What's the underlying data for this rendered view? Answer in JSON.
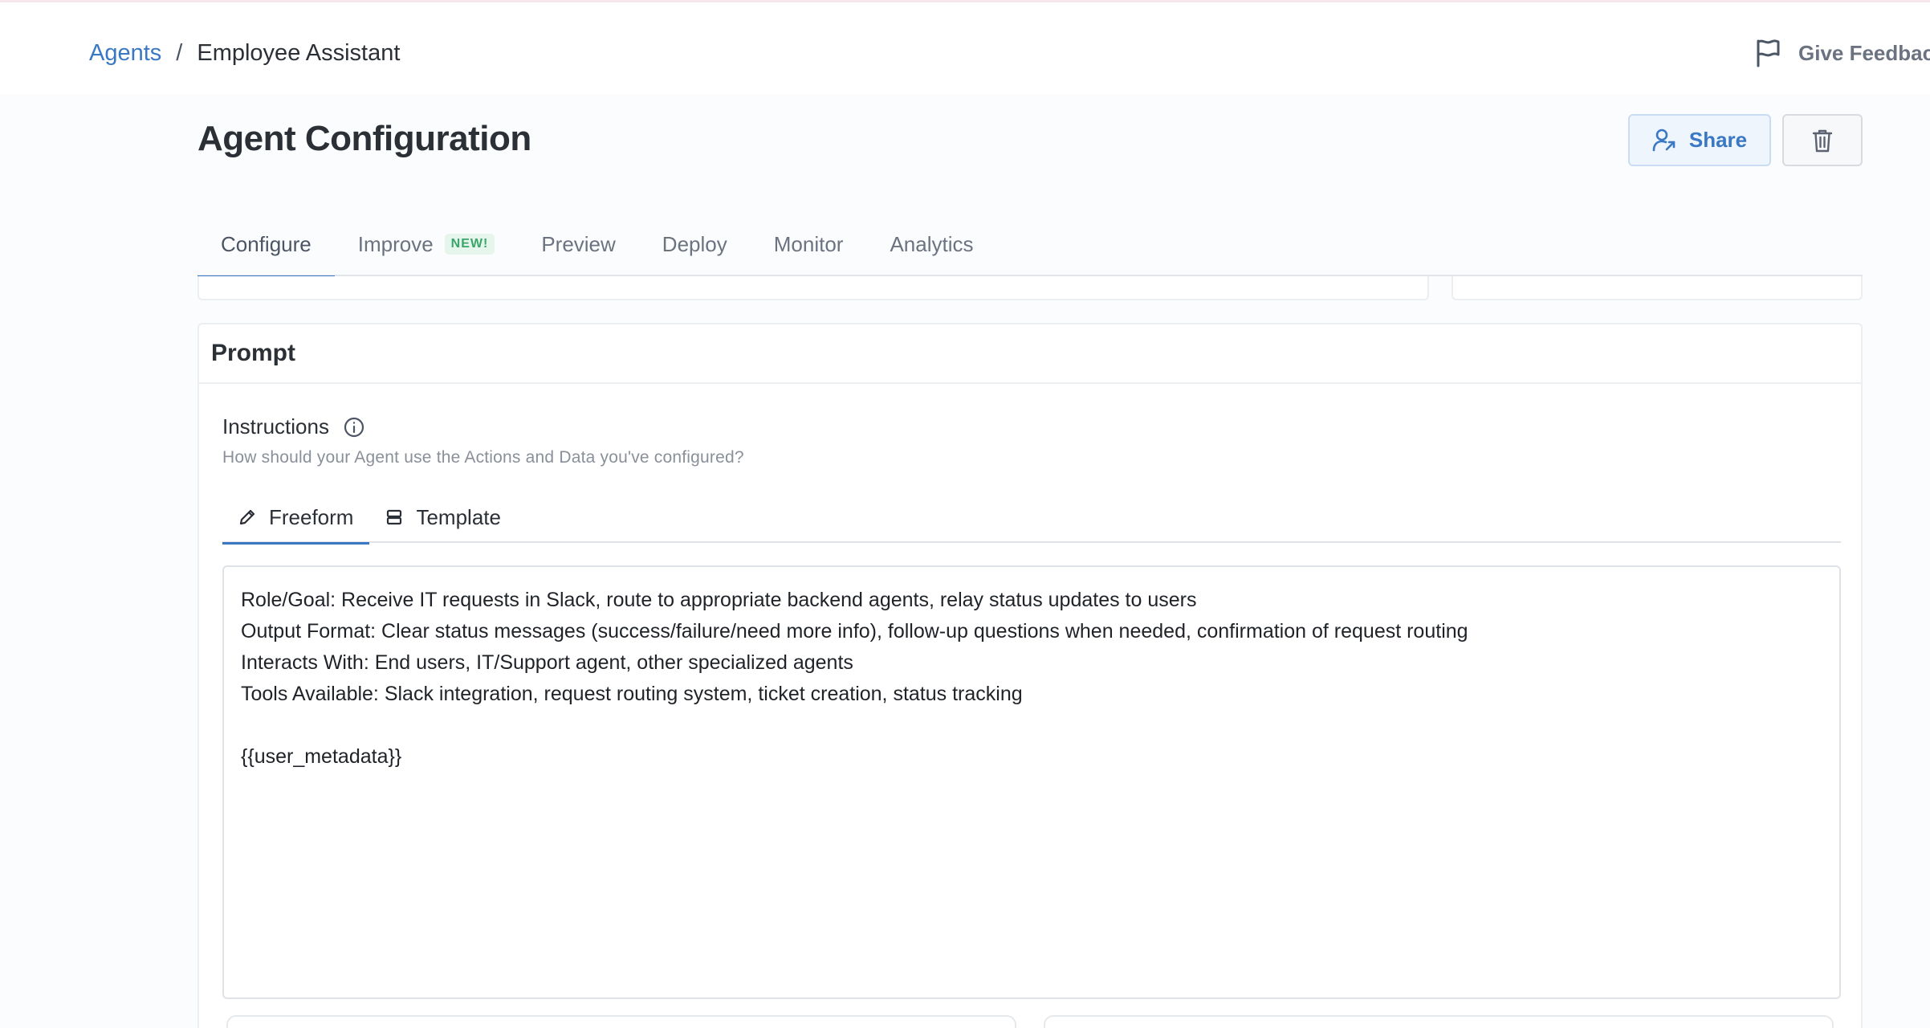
{
  "breadcrumb": {
    "parent": "Agents",
    "separator": "/",
    "current": "Employee Assistant"
  },
  "header": {
    "feedback_label": "Give Feedback",
    "feedback_icon": "flag-icon"
  },
  "page": {
    "title": "Agent Configuration",
    "share_label": "Share",
    "share_icon": "user-share-icon",
    "delete_icon": "trash-icon"
  },
  "tabs": [
    {
      "label": "Configure",
      "active": true
    },
    {
      "label": "Improve",
      "badge": "NEW!"
    },
    {
      "label": "Preview"
    },
    {
      "label": "Deploy"
    },
    {
      "label": "Monitor"
    },
    {
      "label": "Analytics"
    }
  ],
  "prompt": {
    "title": "Prompt",
    "instructions_label": "Instructions",
    "instructions_help": "How should your Agent use the Actions and Data you've configured?",
    "info_icon": "info-icon",
    "modes": [
      {
        "label": "Freeform",
        "icon": "pencil-icon",
        "active": true
      },
      {
        "label": "Template",
        "icon": "template-icon"
      }
    ],
    "editor_lines": [
      "Role/Goal: Receive IT requests in Slack, route to appropriate backend agents, relay status updates to users",
      "Output Format: Clear status messages (success/failure/need more info), follow-up questions when needed, confirmation of request routing",
      "Interacts With: End users, IT/Support agent, other specialized agents",
      "Tools Available: Slack integration, request routing system, ticket creation, status tracking",
      "",
      "{{user_metadata}}"
    ]
  },
  "colors": {
    "accent": "#3b78c3",
    "badge_green": "#3aa66a"
  }
}
